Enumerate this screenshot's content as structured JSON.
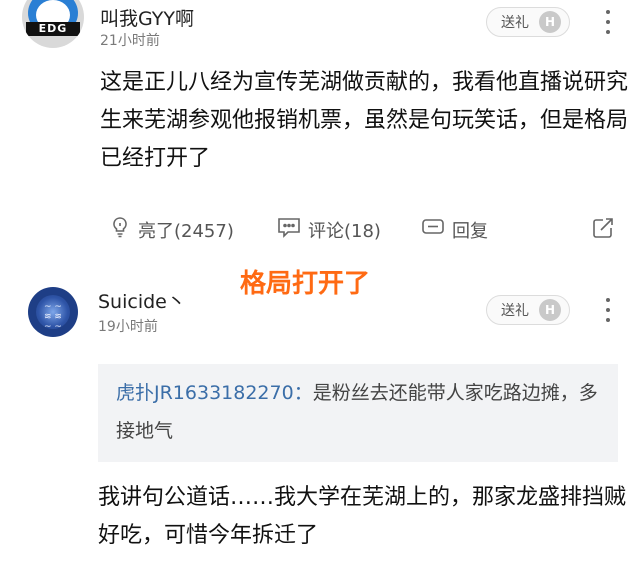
{
  "comments": [
    {
      "username": "叫我GYY啊",
      "avatar_tag": "EDG",
      "time": "21小时前",
      "gift_label": "送礼",
      "gift_badge": "H",
      "text": "这是正儿八经为宣传芜湖做贡献的，我看他直播说研究生来芜湖参观他报销机票，虽然是句玩笑话，但是格局已经打开了",
      "actions": {
        "like": "亮了(2457)",
        "comment": "评论(18)",
        "reply": "回复"
      }
    },
    {
      "username": "Suicide丶",
      "time": "19小时前",
      "gift_label": "送礼",
      "gift_badge": "H",
      "quote": {
        "name": "虎扑JR1633182270：",
        "text": "是粉丝去还能带人家吃路边摊，多接地气"
      },
      "text": "我讲句公道话……我大学在芜湖上的，那家龙盛排挡贼好吃，可惜今年拆迁了"
    }
  ],
  "overlay_caption": "格局打开了",
  "colors": {
    "overlay": "#ff6a13",
    "quote_name": "#3b6ea8",
    "quote_bg": "#f2f3f5"
  },
  "icons": [
    "bulb-icon",
    "comment-icon",
    "reply-icon",
    "share-icon",
    "more-icon"
  ]
}
